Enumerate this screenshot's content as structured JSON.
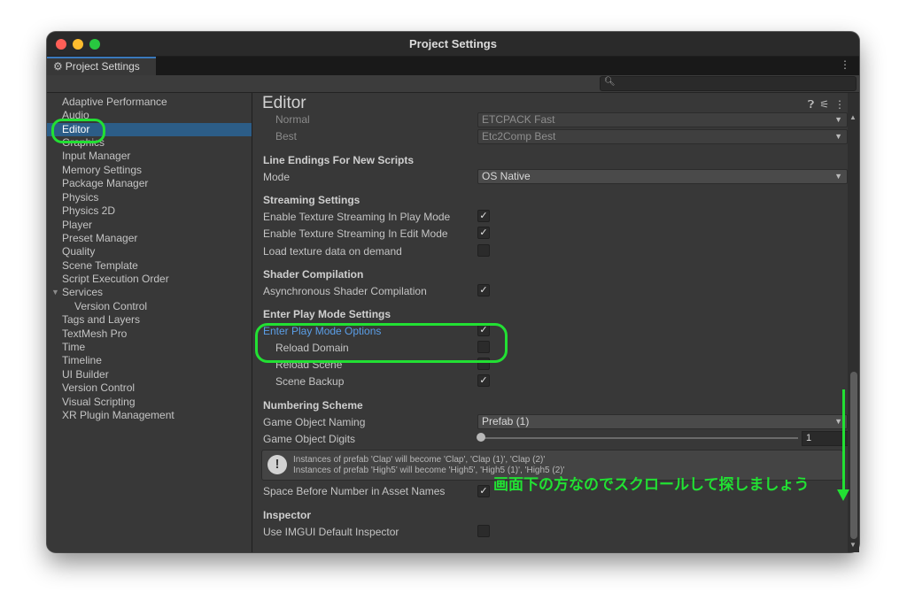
{
  "window": {
    "title": "Project Settings"
  },
  "tab": {
    "label": "Project Settings",
    "icon": "gear-icon"
  },
  "sidebar": {
    "items": [
      {
        "label": "Adaptive Performance"
      },
      {
        "label": "Audio"
      },
      {
        "label": "Editor",
        "selected": true
      },
      {
        "label": "Graphics"
      },
      {
        "label": "Input Manager"
      },
      {
        "label": "Memory Settings"
      },
      {
        "label": "Package Manager"
      },
      {
        "label": "Physics"
      },
      {
        "label": "Physics 2D"
      },
      {
        "label": "Player"
      },
      {
        "label": "Preset Manager"
      },
      {
        "label": "Quality"
      },
      {
        "label": "Scene Template"
      },
      {
        "label": "Script Execution Order"
      },
      {
        "label": "Services",
        "expanded": true
      },
      {
        "label": "Version Control",
        "child": true
      },
      {
        "label": "Tags and Layers"
      },
      {
        "label": "TextMesh Pro"
      },
      {
        "label": "Time"
      },
      {
        "label": "Timeline"
      },
      {
        "label": "UI Builder"
      },
      {
        "label": "Version Control"
      },
      {
        "label": "Visual Scripting"
      },
      {
        "label": "XR Plugin Management"
      }
    ]
  },
  "editor": {
    "title": "Editor",
    "etc": {
      "normal_label": "Normal",
      "normal_value": "ETCPACK Fast",
      "best_label": "Best",
      "best_value": "Etc2Comp Best"
    },
    "line_endings": {
      "header": "Line Endings For New Scripts",
      "mode_label": "Mode",
      "mode_value": "OS Native"
    },
    "streaming": {
      "header": "Streaming Settings",
      "play_label": "Enable Texture Streaming In Play Mode",
      "play_checked": true,
      "edit_label": "Enable Texture Streaming In Edit Mode",
      "edit_checked": true,
      "load_label": "Load texture data on demand",
      "load_checked": false
    },
    "shader": {
      "header": "Shader Compilation",
      "async_label": "Asynchronous Shader Compilation",
      "async_checked": true
    },
    "play_mode": {
      "header": "Enter Play Mode Settings",
      "options_label": "Enter Play Mode Options",
      "options_checked": true,
      "domain_label": "Reload Domain",
      "domain_checked": false,
      "scene_label": "Reload Scene",
      "scene_checked": false,
      "backup_label": "Scene Backup",
      "backup_checked": true
    },
    "numbering": {
      "header": "Numbering Scheme",
      "naming_label": "Game Object Naming",
      "naming_value": "Prefab (1)",
      "digits_label": "Game Object Digits",
      "digits_value": "1",
      "help_line1": "Instances of prefab 'Clap' will become 'Clap', 'Clap (1)', 'Clap (2)'",
      "help_line2": "Instances of prefab 'High5' will become 'High5', 'High5 (1)', 'High5 (2)'",
      "space_label": "Space Before Number in Asset Names",
      "space_checked": true
    },
    "inspector": {
      "header": "Inspector",
      "imgui_label": "Use IMGUI Default Inspector",
      "imgui_checked": false
    }
  },
  "annotation": {
    "text": "画面下の方なのでスクロールして探しましょう",
    "color": "#22e033"
  },
  "colors": {
    "selected": "#2c5d87",
    "link": "#5b9ee6",
    "annotation": "#22e033"
  }
}
